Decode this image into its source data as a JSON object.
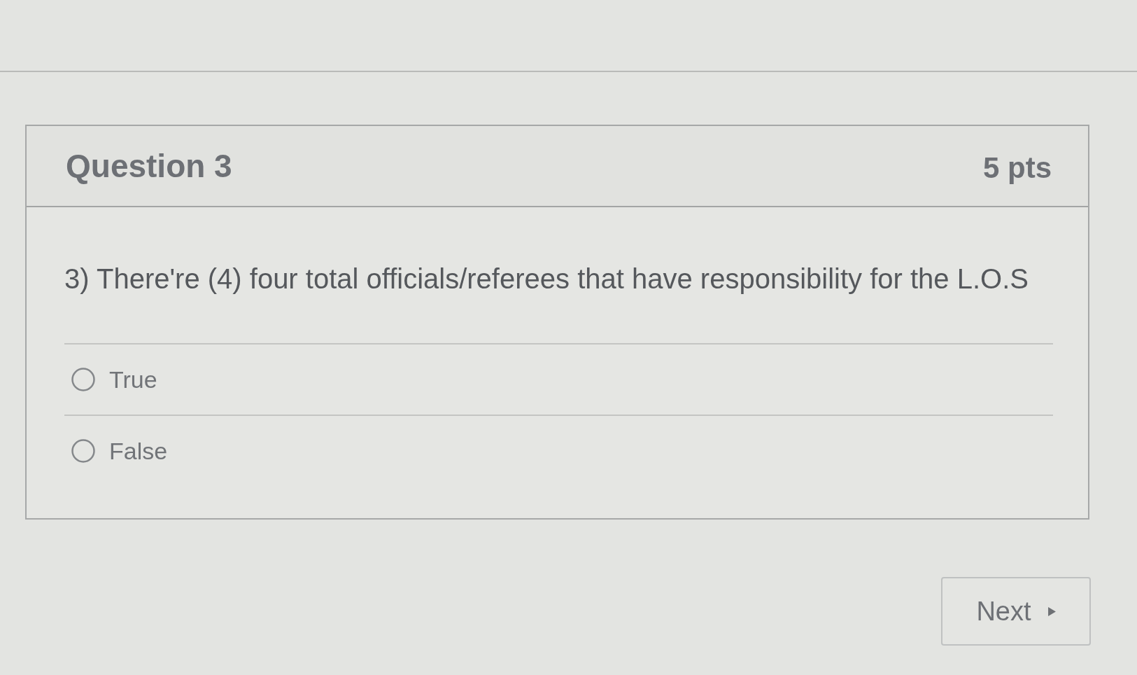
{
  "question": {
    "title": "Question 3",
    "points": "5 pts",
    "text": "3) There're (4) four total officials/referees that have responsibility for the L.O.S",
    "answers": [
      {
        "label": "True",
        "selected": false
      },
      {
        "label": "False",
        "selected": false
      }
    ]
  },
  "next_button": {
    "label": "Next"
  }
}
